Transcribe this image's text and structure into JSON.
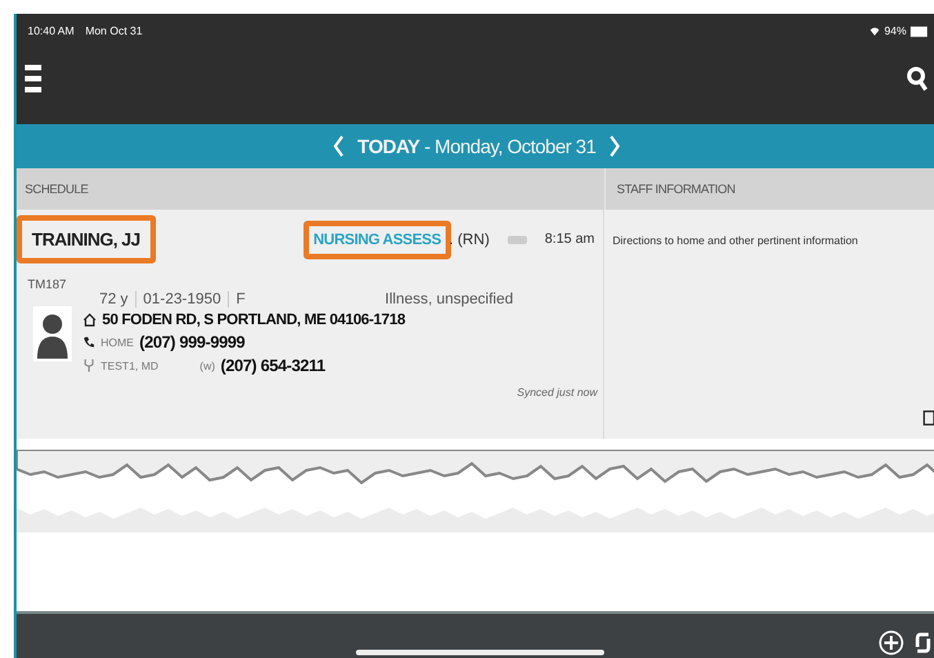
{
  "status_bar": {
    "time": "10:40 AM",
    "date": "Mon Oct 31",
    "battery": "94%"
  },
  "date_bar": {
    "today": "TODAY",
    "date": " - Monday, October 31"
  },
  "columns": [
    "SCHEDULE",
    "STAFF INFORMATION"
  ],
  "visit": {
    "patient": {
      "text": "TRAINING, JJ",
      "highlighted": true
    },
    "service": {
      "text": "NURSING ASSESS",
      "highlighted": true
    },
    "role": ". (RN)",
    "time": "8:15 am",
    "mrn": "TM187",
    "age": "72 y",
    "dob": "01-23-1950",
    "sex": "F",
    "diagnosis": "Illness, unspecified",
    "address": "50 FODEN RD, S PORTLAND, ME 04106-1718",
    "phone_label": "HOME",
    "phone": "(207) 999-9999",
    "physician": "TEST1, MD",
    "work_label": "(w)",
    "work_phone": "(207) 654-3211",
    "sync": "Synced just now"
  },
  "staff_info": "Directions to home and other pertinent information"
}
